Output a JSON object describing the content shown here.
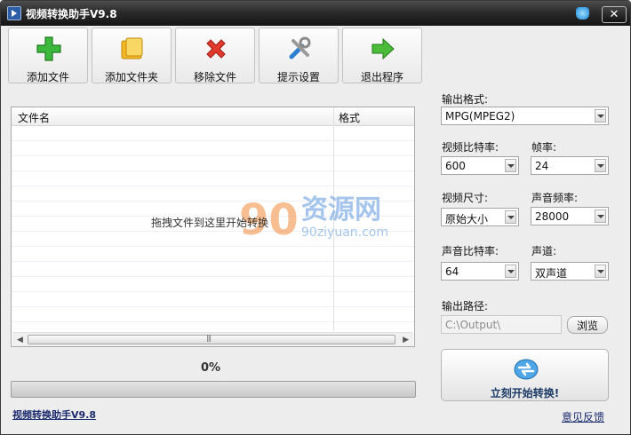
{
  "window": {
    "title": "视频转换助手V9.8"
  },
  "toolbar": {
    "add_file": "添加文件",
    "add_folder": "添加文件夹",
    "remove_file": "移除文件",
    "settings": "提示设置",
    "exit": "退出程序"
  },
  "file_list": {
    "col_name": "文件名",
    "col_format": "格式",
    "drop_hint": "拖拽文件到这里开始转换",
    "rows": []
  },
  "watermark": {
    "brand": "资源网",
    "url": "90ziyuan.com",
    "number": "90"
  },
  "progress": {
    "percent_label": "0%",
    "value": 0
  },
  "settings": {
    "output_format_label": "输出格式:",
    "output_format_value": "MPG(MPEG2)",
    "video_bitrate_label": "视频比特率:",
    "video_bitrate_value": "600",
    "framerate_label": "帧率:",
    "framerate_value": "24",
    "video_size_label": "视频尺寸:",
    "video_size_value": "原始大小",
    "audio_rate_label": "声音频率:",
    "audio_rate_value": "28000",
    "audio_bitrate_label": "声音比特率:",
    "audio_bitrate_value": "64",
    "channels_label": "声道:",
    "channels_value": "双声道",
    "output_path_label": "输出路径:",
    "output_path_value": "C:\\Output\\",
    "browse_label": "浏览"
  },
  "start": {
    "label": "立刻开始转换!"
  },
  "footer": {
    "app_link": "视频转换助手V9.8",
    "feedback": "意见反馈"
  }
}
